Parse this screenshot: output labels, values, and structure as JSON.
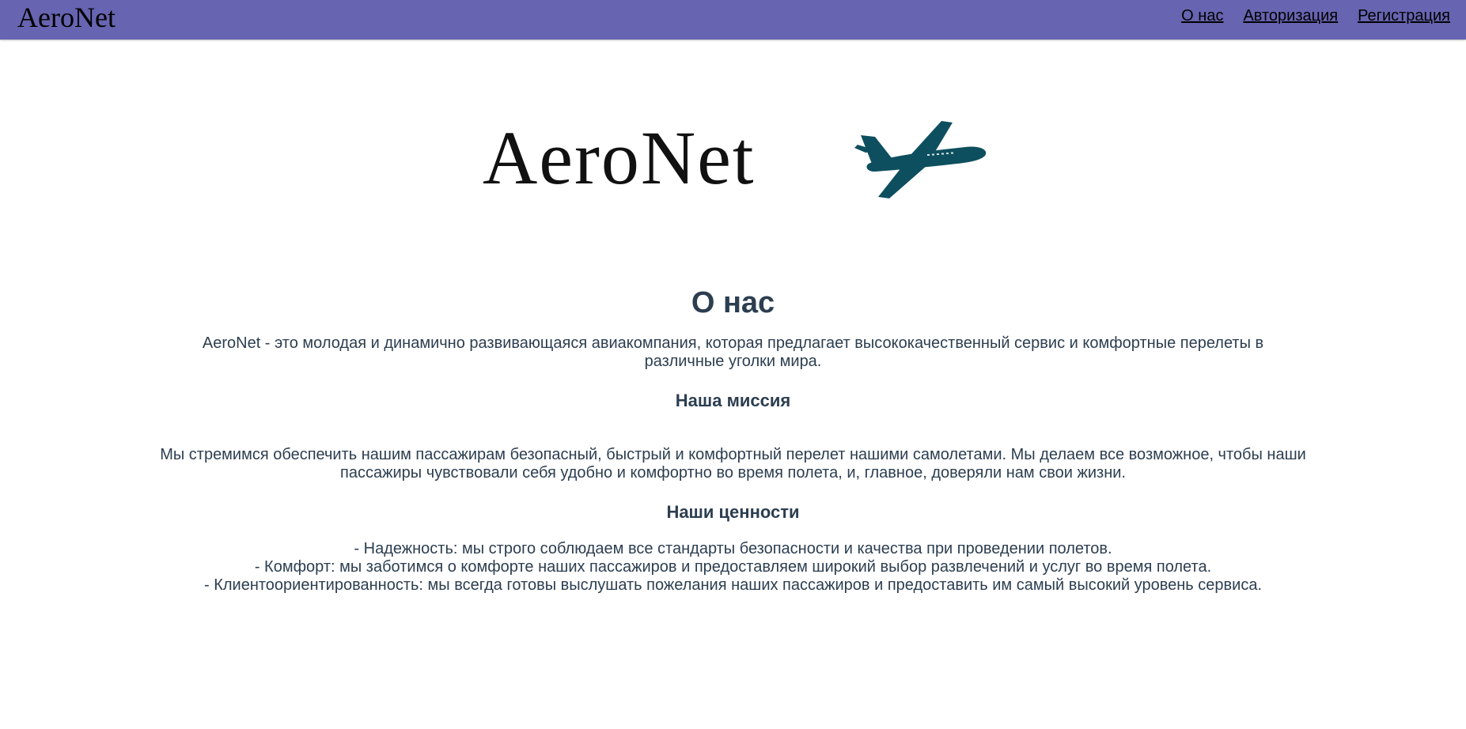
{
  "navbar": {
    "brand": "AeroNet",
    "links": [
      {
        "label": "О нас"
      },
      {
        "label": "Авторизация"
      },
      {
        "label": "Регистрация"
      }
    ],
    "background": "#6764b1"
  },
  "logo": {
    "text": "AeroNet",
    "icon": "airplane-icon",
    "icon_color": "#0e4f5f"
  },
  "about": {
    "title": "О нас",
    "intro": "AeroNet - это молодая и динамично развивающаяся авиакомпания, которая предлагает высококачественный сервис и комфортные перелеты в различные уголки мира.",
    "mission_title": "Наша миссия",
    "mission_text": "Мы стремимся обеспечить нашим пассажирам безопасный, быстрый и комфортный перелет нашими самолетами. Мы делаем все возможное, чтобы наши пассажиры чувствовали себя удобно и комфортно во время полета, и, главное, доверяли нам свои жизни.",
    "values_title": "Наши ценности",
    "values": [
      "- Надежность: мы строго соблюдаем все стандарты безопасности и качества при проведении полетов.",
      "- Комфорт: мы заботимся о комфорте наших пассажиров и предоставляем широкий выбор развлечений и услуг во время полета.",
      "- Клиентоориентированность: мы всегда готовы выслушать пожелания наших пассажиров и предоставить им самый высокий уровень сервиса."
    ]
  }
}
